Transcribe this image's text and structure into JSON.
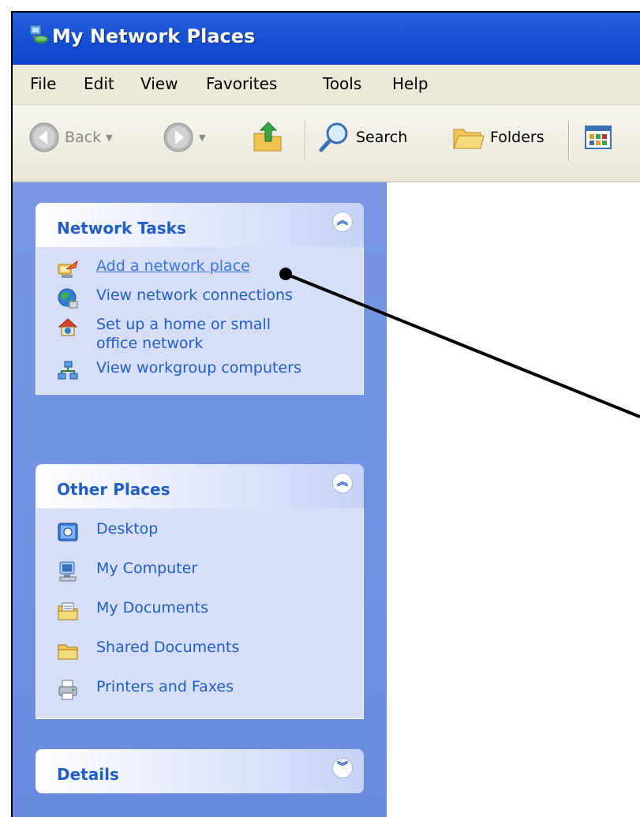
{
  "window": {
    "title": "My Network Places"
  },
  "menubar": {
    "items": [
      "File",
      "Edit",
      "View",
      "Favorites",
      "Tools",
      "Help"
    ]
  },
  "toolbar": {
    "back_label": "Back",
    "search_label": "Search",
    "folders_label": "Folders"
  },
  "panels": {
    "network_tasks": {
      "title": "Network Tasks",
      "items": [
        {
          "label": "Add a network place",
          "icon": "add-network-place-icon"
        },
        {
          "label": "View network connections",
          "icon": "network-connections-icon"
        },
        {
          "label": "Set up a home or small office network",
          "icon": "home-network-icon"
        },
        {
          "label": "View workgroup computers",
          "icon": "workgroup-icon"
        }
      ]
    },
    "other_places": {
      "title": "Other Places",
      "items": [
        {
          "label": "Desktop",
          "icon": "desktop-icon"
        },
        {
          "label": "My Computer",
          "icon": "my-computer-icon"
        },
        {
          "label": "My Documents",
          "icon": "my-documents-icon"
        },
        {
          "label": "Shared Documents",
          "icon": "shared-documents-icon"
        },
        {
          "label": "Printers and Faxes",
          "icon": "printers-faxes-icon"
        }
      ]
    },
    "details": {
      "title": "Details"
    }
  },
  "colors": {
    "titlebar": "#0b44c8",
    "sidebar": "#7898e6",
    "panel_body": "#d6dff7",
    "link": "#215dc6",
    "pointer": "#000000"
  }
}
